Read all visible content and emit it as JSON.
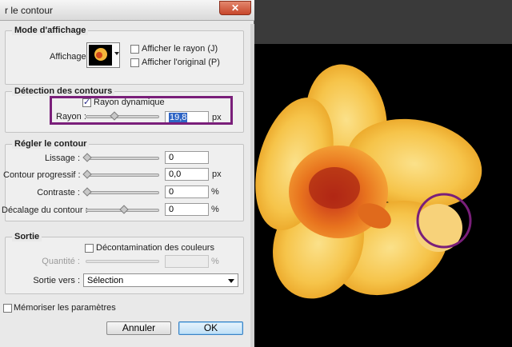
{
  "dialog": {
    "title": "r le contour",
    "close_icon": "close-icon"
  },
  "view_mode": {
    "section_title": "Mode d'affichage",
    "display_label": "Affichage :",
    "show_radius_label": "Afficher le rayon (J)",
    "show_original_label": "Afficher l'original (P)",
    "show_radius_checked": false,
    "show_original_checked": false
  },
  "edge_detection": {
    "section_title": "Détection des contours",
    "smart_radius_label": "Rayon dynamique",
    "smart_radius_checked": true,
    "radius_label": "Rayon :",
    "radius_value": "19,8",
    "radius_unit": "px",
    "radius_slider_level": 0.39
  },
  "adjust_edge": {
    "section_title": "Régler le contour",
    "smooth_label": "Lissage :",
    "smooth_value": "0",
    "feather_label": "Contour progressif :",
    "feather_value": "0,0",
    "feather_unit": "px",
    "contrast_label": "Contraste :",
    "contrast_value": "0",
    "contrast_unit": "%",
    "shift_label": "Décalage du contour :",
    "shift_value": "0",
    "shift_unit": "%",
    "smooth_level": 0,
    "feather_level": 0,
    "contrast_level": 0,
    "shift_level": 0.5
  },
  "output": {
    "section_title": "Sortie",
    "decontaminate_label": "Décontamination des couleurs",
    "decontaminate_checked": false,
    "amount_label": "Quantité :",
    "amount_value": "",
    "amount_unit": "%",
    "output_to_label": "Sortie vers :",
    "output_to_value": "Sélection"
  },
  "footer": {
    "remember_label": "Mémoriser les paramètres",
    "remember_checked": false,
    "cancel_label": "Annuler",
    "ok_label": "OK"
  },
  "colors": {
    "highlight": "#7a1f7a",
    "petal": "#f7c04a",
    "corona": "#ee7a1e",
    "selection": "#2f65c5"
  }
}
